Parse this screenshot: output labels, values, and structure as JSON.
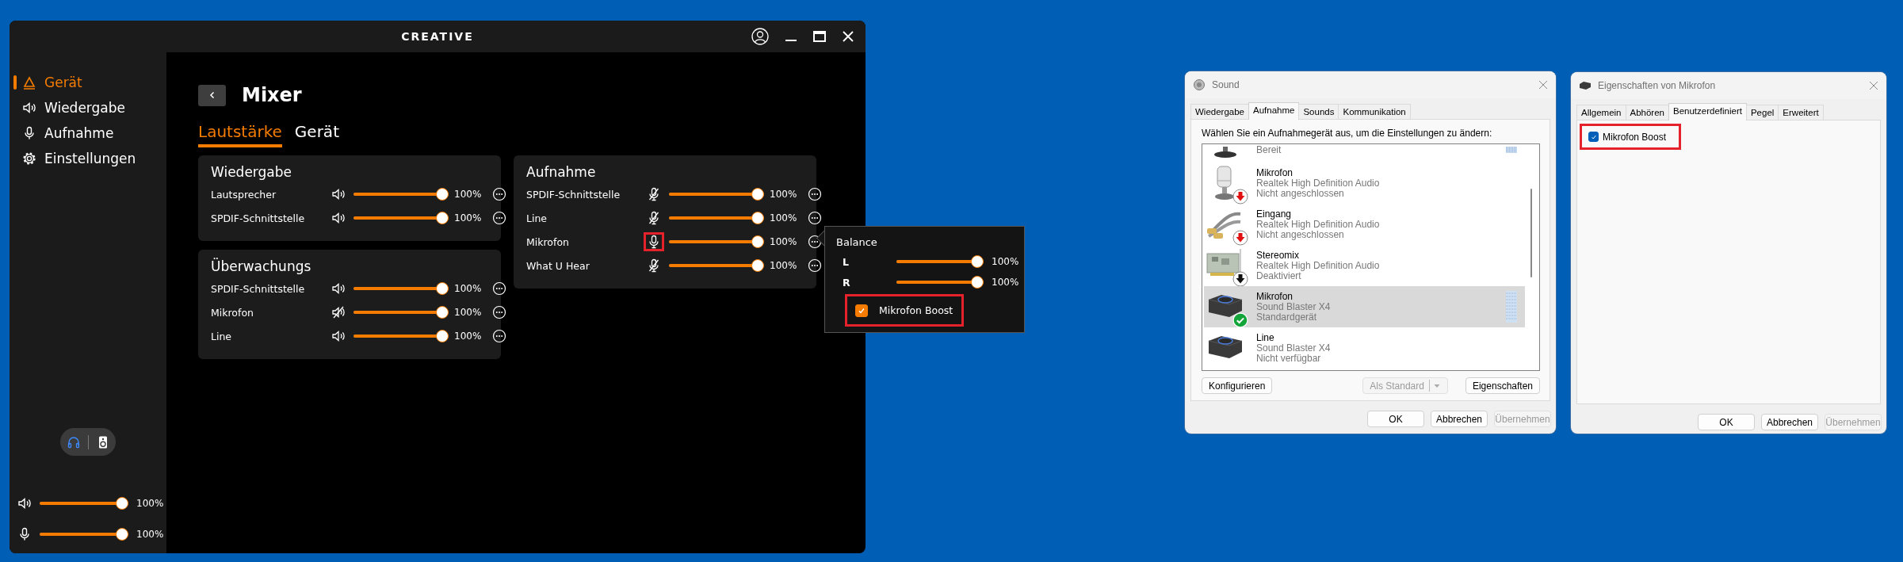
{
  "creative_app": {
    "logo": "CREATIVE",
    "sidebar": {
      "items": [
        {
          "label": "Gerät",
          "selected": true
        },
        {
          "label": "Wiedergabe",
          "selected": false
        },
        {
          "label": "Aufnahme",
          "selected": false
        },
        {
          "label": "Einstellungen",
          "selected": false
        }
      ],
      "output_modes": [
        {
          "kind": "headphones",
          "selected": true
        },
        {
          "kind": "speaker-box",
          "selected": false
        }
      ],
      "master_volumes": [
        {
          "kind": "speaker",
          "level": 1,
          "reading": "100%"
        },
        {
          "kind": "mic",
          "level": 1,
          "reading": "100%"
        }
      ]
    },
    "page_title": "Mixer",
    "tabs": [
      {
        "label": "Lautstärke",
        "selected": true
      },
      {
        "label": "Gerät",
        "selected": false
      }
    ],
    "panels": [
      {
        "title": "Wiedergabe",
        "channels": [
          {
            "name": "Lautsprecher",
            "kind": "speaker",
            "muted": false,
            "level": 1,
            "reading": "100%"
          },
          {
            "name": "SPDIF-Schnittstelle",
            "kind": "speaker",
            "muted": false,
            "level": 1,
            "reading": "100%"
          }
        ]
      },
      {
        "title": "Überwachungs",
        "channels": [
          {
            "name": "SPDIF-Schnittstelle",
            "kind": "speaker",
            "muted": false,
            "level": 1,
            "reading": "100%"
          },
          {
            "name": "Mikrofon",
            "kind": "speaker",
            "muted": true,
            "level": 1,
            "reading": "100%"
          },
          {
            "name": "Line",
            "kind": "speaker",
            "muted": false,
            "level": 1,
            "reading": "100%"
          }
        ]
      },
      {
        "title": "Aufnahme",
        "channels": [
          {
            "name": "SPDIF-Schnittstelle",
            "kind": "mic",
            "muted": true,
            "highlighted": false,
            "level": 1,
            "reading": "100%"
          },
          {
            "name": "Line",
            "kind": "mic",
            "muted": true,
            "highlighted": false,
            "level": 1,
            "reading": "100%"
          },
          {
            "name": "Mikrofon",
            "kind": "mic",
            "muted": false,
            "highlighted": true,
            "level": 1,
            "reading": "100%"
          },
          {
            "name": "What U Hear",
            "kind": "mic",
            "muted": true,
            "highlighted": false,
            "level": 1,
            "reading": "100%"
          }
        ]
      }
    ],
    "balance_popover": {
      "title": "Balance",
      "channels": [
        {
          "name": "L",
          "level": 1,
          "reading": "100%"
        },
        {
          "name": "R",
          "level": 1,
          "reading": "100%"
        }
      ],
      "boost": {
        "label": "Mikrofon Boost",
        "checked": true,
        "highlighted": true
      }
    }
  },
  "sound_dialog": {
    "title": "Sound",
    "tabs": [
      {
        "label": "Wiedergabe",
        "selected": false
      },
      {
        "label": "Aufnahme",
        "selected": true
      },
      {
        "label": "Sounds",
        "selected": false
      },
      {
        "label": "Kommunikation",
        "selected": false
      }
    ],
    "instruction": "Wählen Sie ein Aufnahmegerät aus, um die Einstellungen zu ändern:",
    "devices": [
      {
        "kind": "mic-stand",
        "status": "Bereit",
        "meter": true,
        "selected": false
      },
      {
        "kind": "microphone",
        "name": "Mikrofon",
        "device": "Realtek High Definition Audio",
        "status": "Nicht angeschlossen",
        "badge": {
          "kind": "unplugged"
        },
        "meter": false,
        "selected": false
      },
      {
        "kind": "cable",
        "name": "Eingang",
        "device": "Realtek High Definition Audio",
        "status": "Nicht angeschlossen",
        "badge": {
          "kind": "unplugged"
        },
        "meter": false,
        "selected": false
      },
      {
        "kind": "sound-card",
        "name": "Stereomix",
        "device": "Realtek High Definition Audio",
        "status": "Deaktiviert",
        "badge": {
          "kind": "disabled"
        },
        "meter": false,
        "selected": false
      },
      {
        "kind": "audio-interface",
        "name": "Mikrofon",
        "device": "Sound Blaster X4",
        "status": "Standardgerät",
        "badge": {
          "kind": "default"
        },
        "meter": true,
        "selected": true
      },
      {
        "kind": "audio-interface",
        "name": "Line",
        "device": "Sound Blaster X4",
        "status": "Nicht verfügbar",
        "meter": false,
        "selected": false
      }
    ],
    "buttons": [
      {
        "label": "Konfigurieren",
        "kind": "plain",
        "disabled": false
      },
      {
        "label": "Als Standard",
        "kind": "split",
        "disabled": true
      },
      {
        "label": "Eigenschaften",
        "kind": "plain",
        "disabled": false
      }
    ],
    "footer_buttons": [
      {
        "label": "OK",
        "disabled": false
      },
      {
        "label": "Abbrechen",
        "disabled": false
      },
      {
        "label": "Übernehmen",
        "disabled": true
      }
    ]
  },
  "properties_dialog": {
    "title": "Eigenschaften von Mikrofon",
    "tabs": [
      {
        "label": "Allgemein",
        "selected": false
      },
      {
        "label": "Abhören",
        "selected": false
      },
      {
        "label": "Benutzerdefiniert",
        "selected": true
      },
      {
        "label": "Pegel",
        "selected": false
      },
      {
        "label": "Erweitert",
        "selected": false
      }
    ],
    "boost": {
      "label": "Mikrofon Boost",
      "checked": true,
      "highlighted": true
    },
    "footer_buttons": [
      {
        "label": "OK",
        "disabled": false
      },
      {
        "label": "Abbrechen",
        "disabled": false
      },
      {
        "label": "Übernehmen",
        "disabled": true
      }
    ]
  }
}
